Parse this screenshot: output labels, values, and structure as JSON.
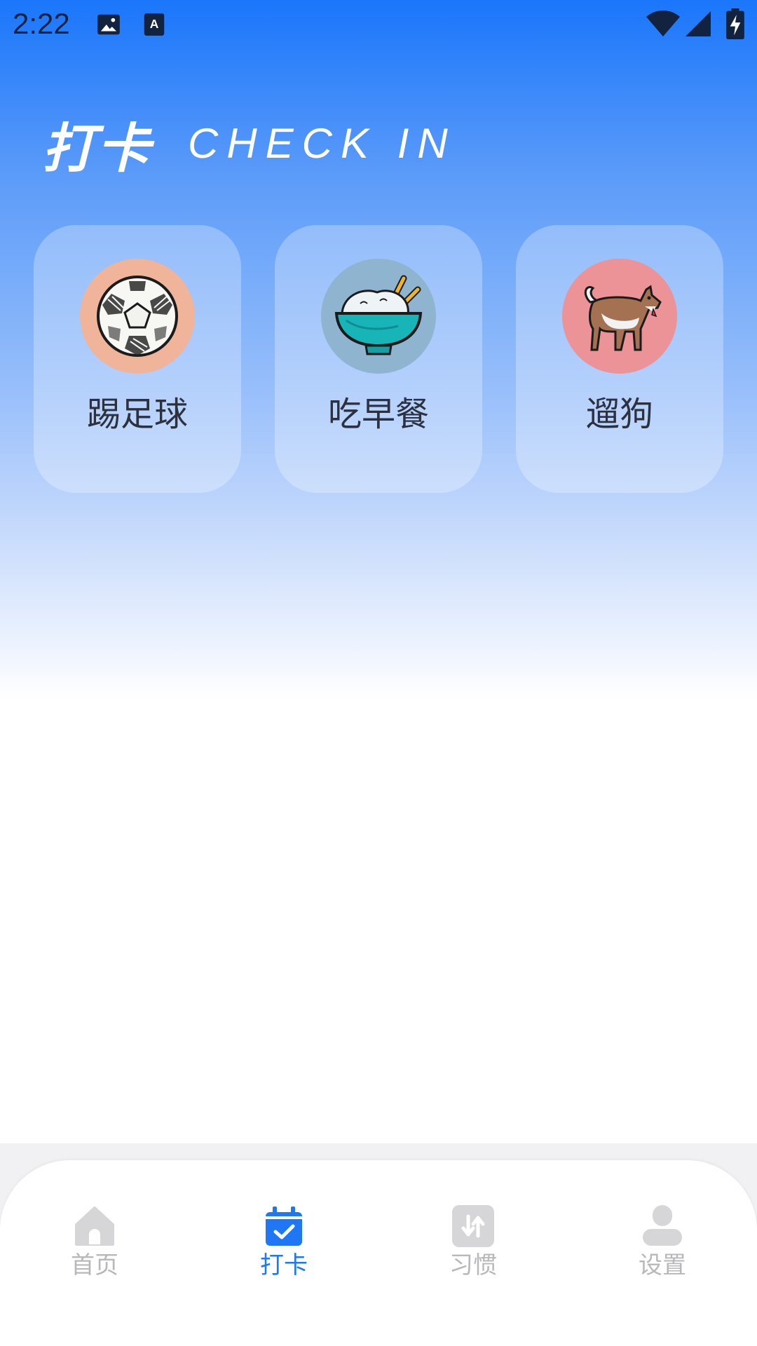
{
  "status_bar": {
    "time": "2:22",
    "icons": [
      "image-icon",
      "text-a-icon",
      "wifi-icon",
      "signal-icon",
      "battery-charging-icon"
    ]
  },
  "header": {
    "title": "打卡",
    "subtitle": "CHECK IN"
  },
  "cards": [
    {
      "label": "踢足球",
      "icon": "soccer-ball-icon",
      "icon_bg": "#efb49a"
    },
    {
      "label": "吃早餐",
      "icon": "rice-bowl-icon",
      "icon_bg": "#8fb4d0"
    },
    {
      "label": "遛狗",
      "icon": "dog-icon",
      "icon_bg": "#eb9396"
    }
  ],
  "bottom_nav": {
    "items": [
      {
        "label": "首页",
        "icon": "home-icon",
        "active": false
      },
      {
        "label": "打卡",
        "icon": "calendar-check-icon",
        "active": true
      },
      {
        "label": "习惯",
        "icon": "swap-arrows-icon",
        "active": false
      },
      {
        "label": "设置",
        "icon": "user-icon",
        "active": false
      }
    ],
    "active_color": "#1f77f5",
    "inactive_color": "#b8b8bc"
  }
}
